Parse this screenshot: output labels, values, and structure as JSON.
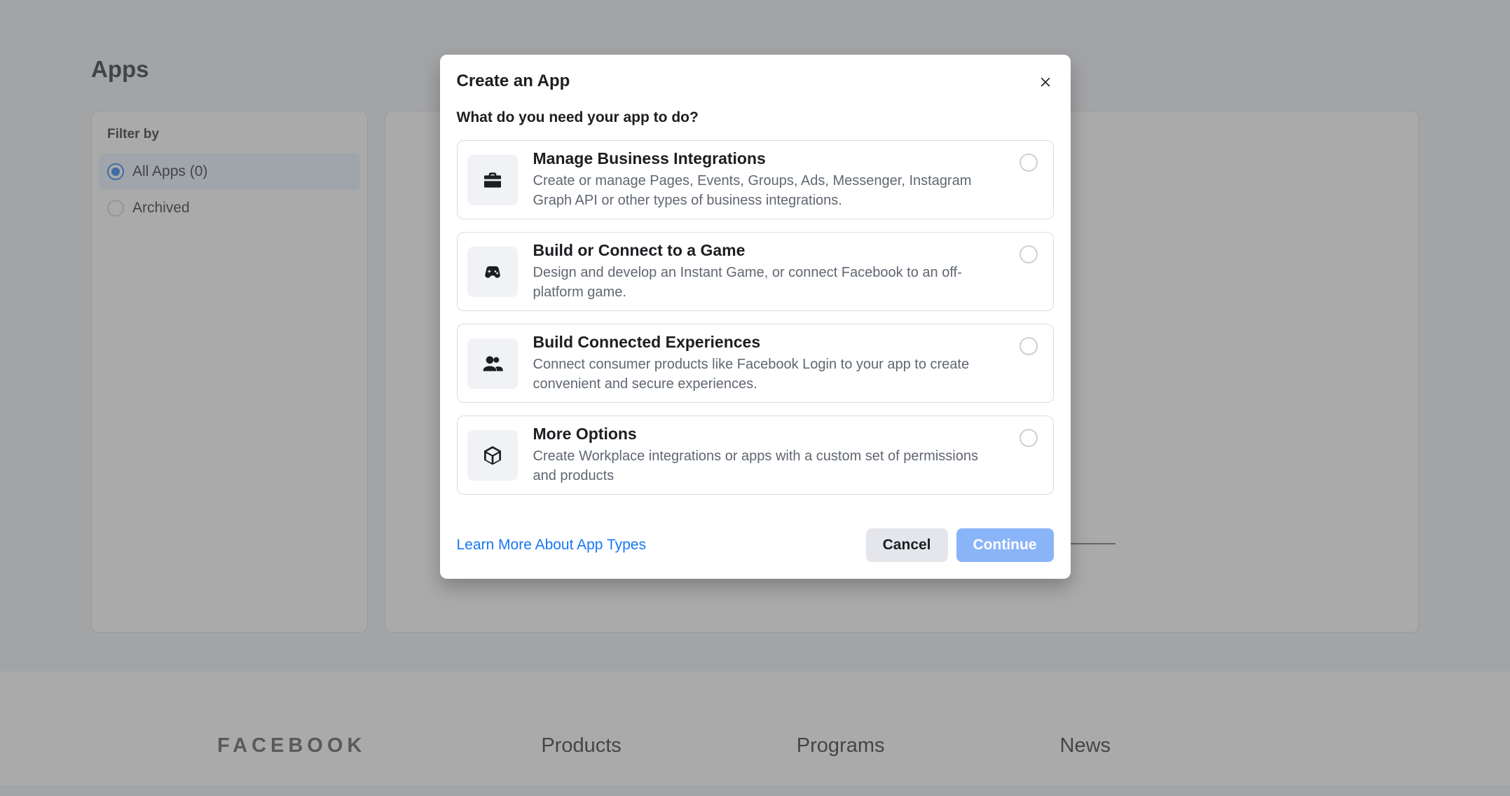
{
  "pageTitle": "Apps",
  "sidebar": {
    "filterLabel": "Filter by",
    "items": [
      {
        "label": "All Apps (0)",
        "selected": true
      },
      {
        "label": "Archived",
        "selected": false
      }
    ]
  },
  "footer": {
    "brand": "FACEBOOK",
    "columns": [
      {
        "title": "Products"
      },
      {
        "title": "Programs"
      },
      {
        "title": "News"
      }
    ]
  },
  "modal": {
    "title": "Create an App",
    "subtitle": "What do you need your app to do?",
    "options": [
      {
        "title": "Manage Business Integrations",
        "desc": "Create or manage Pages, Events, Groups, Ads, Messenger, Instagram Graph API or other types of business integrations.",
        "icon": "briefcase"
      },
      {
        "title": "Build or Connect to a Game",
        "desc": "Design and develop an Instant Game, or connect Facebook to an off-platform game.",
        "icon": "game"
      },
      {
        "title": "Build Connected Experiences",
        "desc": "Connect consumer products like Facebook Login to your app to create convenient and secure experiences.",
        "icon": "people"
      },
      {
        "title": "More Options",
        "desc": "Create Workplace integrations or apps with a custom set of permissions and products",
        "icon": "cube"
      }
    ],
    "learnMore": "Learn More About App Types",
    "cancel": "Cancel",
    "continue": "Continue"
  }
}
